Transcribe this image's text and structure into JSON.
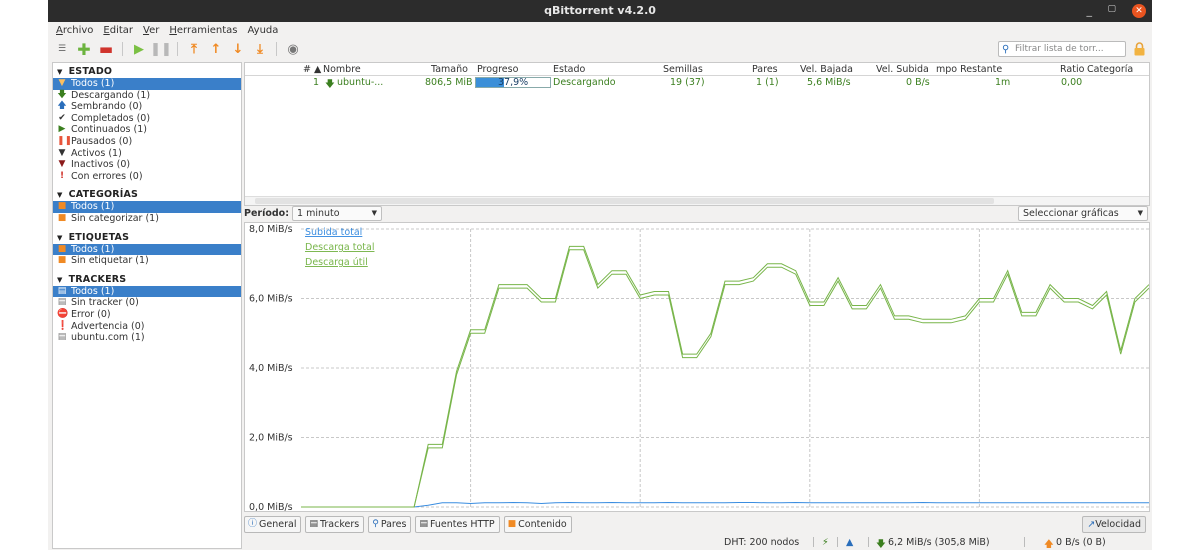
{
  "window": {
    "title": "qBittorrent v4.2.0"
  },
  "menu": [
    {
      "key": "A",
      "rest": "rchivo"
    },
    {
      "key": "E",
      "rest": "ditar"
    },
    {
      "key": "V",
      "rest": "er"
    },
    {
      "key": "H",
      "rest": "erramientas"
    },
    {
      "key": "",
      "rest": "Ayuda"
    }
  ],
  "toolbar": {
    "buttons": [
      "add-link-icon",
      "add-torrent-icon",
      "remove-icon",
      "resume-icon",
      "pause-icon",
      "move-top-icon",
      "move-up-icon",
      "move-down-icon",
      "move-bottom-icon",
      "options-icon"
    ],
    "search_placeholder": "Filtrar lista de torr..."
  },
  "sidebar": {
    "estado": {
      "title": "ESTADO",
      "items": [
        {
          "label": "Todos (1)",
          "icon": "filter",
          "selected": true
        },
        {
          "label": "Descargando (1)",
          "icon": "down"
        },
        {
          "label": "Sembrando (0)",
          "icon": "up"
        },
        {
          "label": "Completados (0)",
          "icon": "check"
        },
        {
          "label": "Continuados (1)",
          "icon": "play"
        },
        {
          "label": "Pausados (0)",
          "icon": "pause"
        },
        {
          "label": "Activos (1)",
          "icon": "filter"
        },
        {
          "label": "Inactivos (0)",
          "icon": "filter"
        },
        {
          "label": "Con errores (0)",
          "icon": "error"
        }
      ]
    },
    "categorias": {
      "title": "CATEGORÍAS",
      "items": [
        {
          "label": "Todos (1)",
          "selected": true
        },
        {
          "label": "Sin categorizar (1)"
        }
      ]
    },
    "etiquetas": {
      "title": "ETIQUETAS",
      "items": [
        {
          "label": "Todos (1)",
          "selected": true
        },
        {
          "label": "Sin etiquetar (1)"
        }
      ]
    },
    "trackers": {
      "title": "TRACKERS",
      "items": [
        {
          "label": "Todos (1)",
          "selected": true
        },
        {
          "label": "Sin tracker (0)"
        },
        {
          "label": "Error (0)"
        },
        {
          "label": "Advertencia (0)"
        },
        {
          "label": "ubuntu.com (1)"
        }
      ]
    }
  },
  "table": {
    "headers": {
      "num": "# ▲",
      "name": "Nombre",
      "size": "Tamaño",
      "progress": "Progreso",
      "status": "Estado",
      "seeds": "Semillas",
      "peers": "Pares",
      "down": "Vel. Bajada",
      "up": "Vel. Subida",
      "eta": "mpo Restante",
      "ratio": "Ratio",
      "category": "Categoría"
    },
    "rows": [
      {
        "num": "1",
        "name": "ubuntu-...",
        "size": "806,5 MiB",
        "progress": "37,9%",
        "progress_value": 0.379,
        "status": "Descargando",
        "seeds": "19 (37)",
        "peers": "1 (1)",
        "down": "5,6 MiB/s",
        "up": "0 B/s",
        "eta": "1m",
        "ratio": "0,00"
      }
    ]
  },
  "period": {
    "label": "Período:",
    "value": "1 minuto",
    "select_graphs": "Seleccionar gráficas"
  },
  "chart_data": {
    "type": "line",
    "ylim": [
      0,
      8
    ],
    "yticks": [
      "0,0 MiB/s",
      "2,0 MiB/s",
      "4,0 MiB/s",
      "6,0 MiB/s",
      "8,0 MiB/s"
    ],
    "ytick_values": [
      0,
      2,
      4,
      6,
      8
    ],
    "grid": true,
    "legend_position": "top-left",
    "series": [
      {
        "name": "Subida total",
        "color": "#3a8de0",
        "values": [
          0,
          0,
          0,
          0,
          0,
          0,
          0,
          0,
          0,
          0.05,
          0.12,
          0.12,
          0.1,
          0.12,
          0.12,
          0.13,
          0.12,
          0.1,
          0.12,
          0.13,
          0.12,
          0.12,
          0.13,
          0.12,
          0.12,
          0.12,
          0.13,
          0.12,
          0.12,
          0.12,
          0.12,
          0.13,
          0.13,
          0.12,
          0.12,
          0.13,
          0.12,
          0.12,
          0.12,
          0.12,
          0.12,
          0.12,
          0.12,
          0.12,
          0.13,
          0.12,
          0.12,
          0.12,
          0.12,
          0.12,
          0.12,
          0.12,
          0.12,
          0.12,
          0.12,
          0.12,
          0.12,
          0.12,
          0.12,
          0.12,
          0.12
        ]
      },
      {
        "name": "Descarga total",
        "color": "#78b54a",
        "values": [
          0,
          0,
          0,
          0,
          0,
          0,
          0,
          0,
          0,
          1.8,
          1.8,
          3.9,
          5.1,
          5.1,
          6.4,
          6.4,
          6.4,
          6.0,
          6.0,
          7.5,
          7.5,
          6.4,
          6.8,
          6.8,
          6.1,
          6.2,
          6.2,
          4.4,
          4.4,
          5.0,
          6.5,
          6.5,
          6.6,
          7.0,
          7.0,
          6.8,
          5.9,
          5.9,
          6.6,
          5.8,
          5.8,
          6.4,
          5.5,
          5.5,
          5.4,
          5.4,
          5.4,
          5.5,
          6.0,
          6.0,
          6.8,
          5.6,
          5.6,
          6.4,
          6.0,
          6.0,
          5.8,
          6.2,
          4.5,
          6.0,
          6.4
        ]
      },
      {
        "name": "Descarga útil",
        "color": "#78b54a",
        "values": [
          0,
          0,
          0,
          0,
          0,
          0,
          0,
          0,
          0,
          1.7,
          1.7,
          3.8,
          5.0,
          5.0,
          6.3,
          6.3,
          6.3,
          5.9,
          5.9,
          7.4,
          7.4,
          6.3,
          6.7,
          6.7,
          6.0,
          6.1,
          6.1,
          4.3,
          4.3,
          4.9,
          6.4,
          6.4,
          6.5,
          6.9,
          6.9,
          6.7,
          5.8,
          5.8,
          6.5,
          5.7,
          5.7,
          6.3,
          5.4,
          5.4,
          5.3,
          5.3,
          5.3,
          5.4,
          5.9,
          5.9,
          6.7,
          5.5,
          5.5,
          6.3,
          5.9,
          5.9,
          5.7,
          6.1,
          4.4,
          5.9,
          6.3
        ]
      }
    ]
  },
  "tabs": [
    {
      "label": "General",
      "icon": "info"
    },
    {
      "label": "Trackers",
      "icon": "list"
    },
    {
      "label": "Pares",
      "icon": "search"
    },
    {
      "label": "Fuentes HTTP",
      "icon": "list"
    },
    {
      "label": "Contenido",
      "icon": "folder"
    }
  ],
  "velocity_button": "Velocidad",
  "status": {
    "dht": "DHT: 200 nodos",
    "down": "6,2 MiB/s (305,8 MiB)",
    "up": "0 B/s (0 B)"
  }
}
